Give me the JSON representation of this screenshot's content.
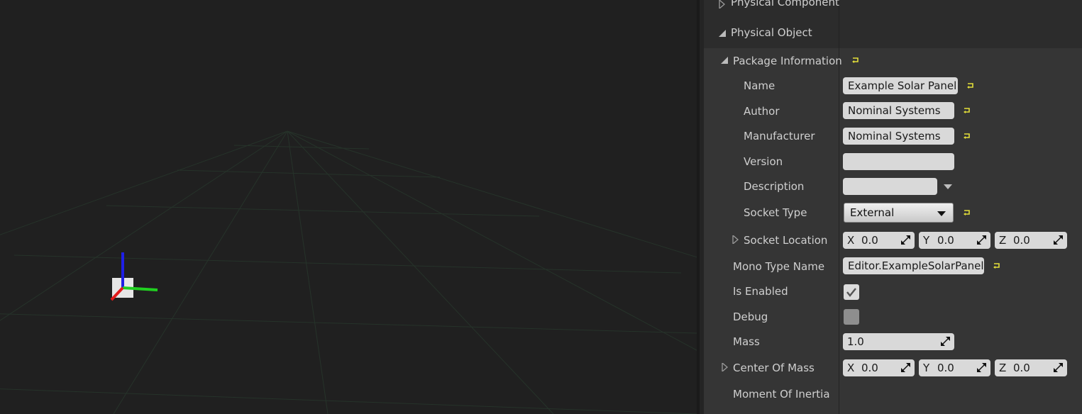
{
  "colors": {
    "viewport_bg": "#202020",
    "grid": "#27352a",
    "panel_bg": "#353535",
    "field_bg": "#d9d9d9",
    "reset_arrow": "#e3df3a",
    "axis_x": "#e21b1b",
    "axis_y": "#20d020",
    "axis_z": "#1f1fe6"
  },
  "details": {
    "physical_component": {
      "label": "Physical Component",
      "expanded": false
    },
    "physical_object": {
      "label": "Physical Object",
      "expanded": true
    },
    "package_information": {
      "label": "Package Information",
      "expanded": true,
      "name": {
        "label": "Name",
        "value": "Example Solar Panel"
      },
      "author": {
        "label": "Author",
        "value": "Nominal Systems"
      },
      "manufacturer": {
        "label": "Manufacturer",
        "value": "Nominal Systems"
      },
      "version": {
        "label": "Version",
        "value": ""
      },
      "description": {
        "label": "Description",
        "value": ""
      },
      "socket_type": {
        "label": "Socket Type",
        "value": "External"
      },
      "socket_location": {
        "label": "Socket Location",
        "x_label": "X",
        "x": "0.0",
        "y_label": "Y",
        "y": "0.0",
        "z_label": "Z",
        "z": "0.0"
      }
    },
    "mono_type_name": {
      "label": "Mono Type Name",
      "value": "Editor.ExampleSolarPanel"
    },
    "is_enabled": {
      "label": "Is Enabled",
      "checked": true
    },
    "debug": {
      "label": "Debug",
      "checked": false
    },
    "mass": {
      "label": "Mass",
      "value": "1.0"
    },
    "center_of_mass": {
      "label": "Center Of Mass",
      "x_label": "X",
      "x": "0.0",
      "y_label": "Y",
      "y": "0.0",
      "z_label": "Z",
      "z": "0.0"
    },
    "moment_of_inertia": {
      "label": "Moment Of Inertia"
    }
  }
}
